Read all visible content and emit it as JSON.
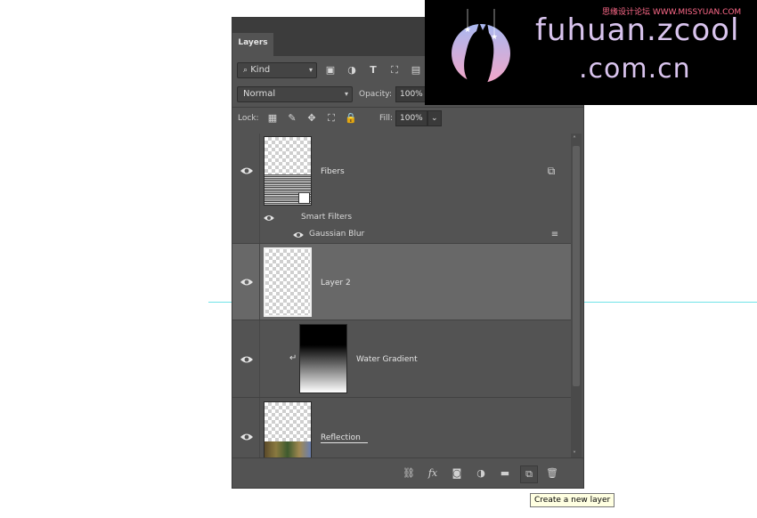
{
  "panel": {
    "tab_label": "Layers",
    "filter": {
      "kind_label": "Kind"
    },
    "blend_mode": "Normal",
    "opacity_label": "Opacity:",
    "opacity_value": "100%",
    "lock_label": "Lock:",
    "fill_label": "Fill:",
    "fill_value": "100%"
  },
  "layers": [
    {
      "name": "Fibers",
      "smart_filters_label": "Smart Filters",
      "filter_name": "Gaussian Blur"
    },
    {
      "name": "Layer 2"
    },
    {
      "name": "Water Gradient"
    },
    {
      "name": "Reflection"
    }
  ],
  "footer": {
    "icons": [
      "link-icon",
      "fx-icon",
      "mask-icon",
      "adjustment-icon",
      "folder-icon",
      "new-layer-icon",
      "trash-icon"
    ]
  },
  "tooltip": "Create a new layer",
  "watermark": {
    "line1": "fuhuan.zcool",
    "line2": ".com.cn",
    "tagline": "思缘设计论坛 WWW.MISSYUAN.COM"
  },
  "colors": {
    "panel_bg": "#535353",
    "selected_row": "#686868",
    "guide_line": "#6fe3e8",
    "brand_text": "#d9c4ee"
  }
}
